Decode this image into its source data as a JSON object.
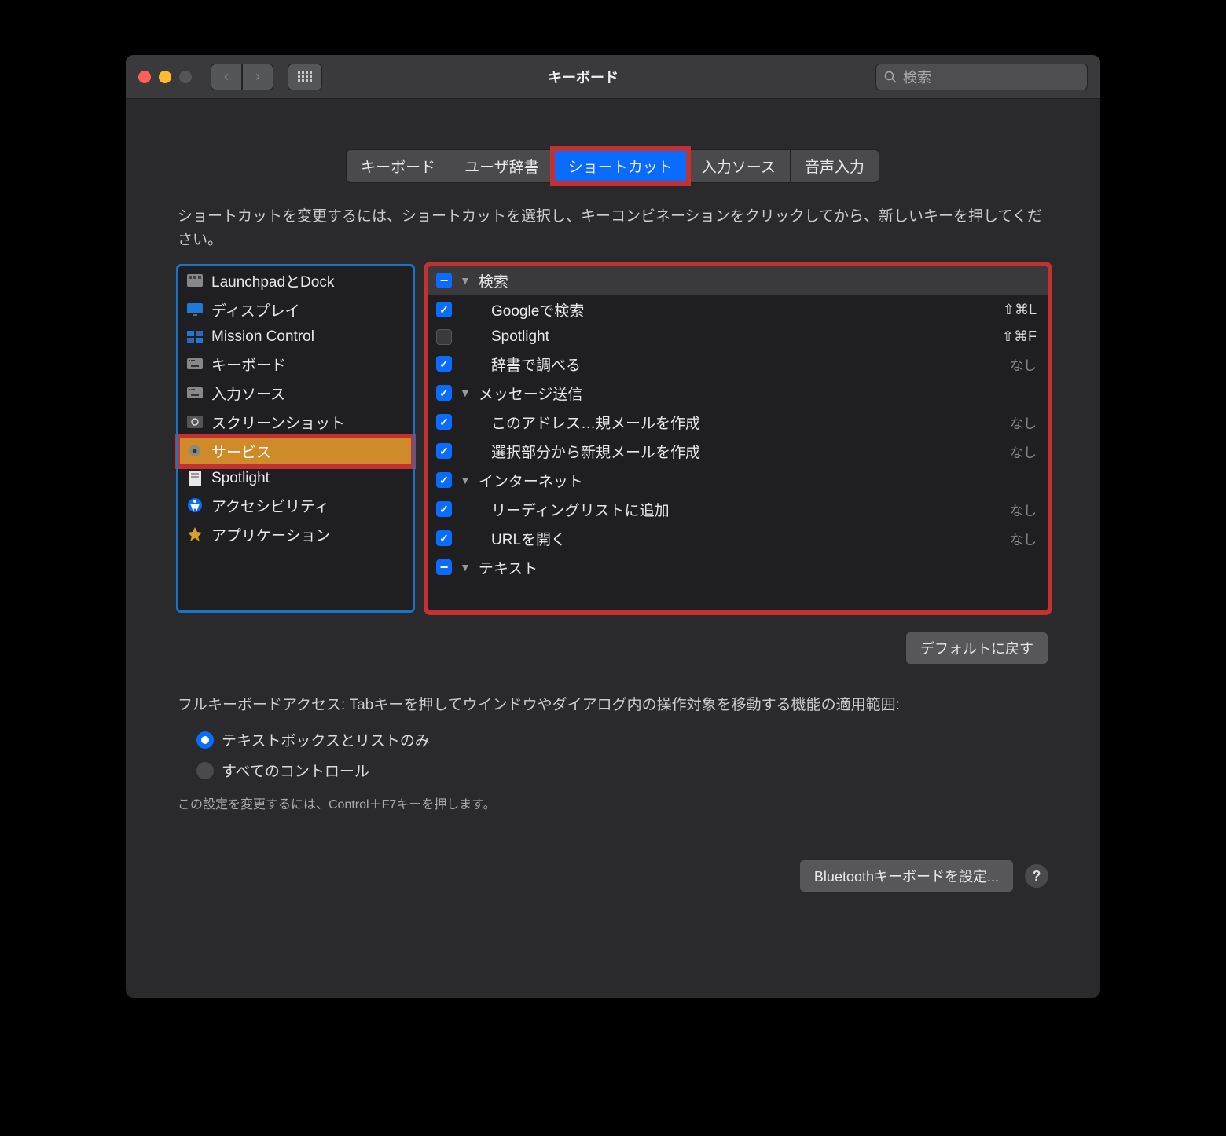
{
  "window": {
    "title": "キーボード",
    "search_placeholder": "検索"
  },
  "tabs": [
    {
      "label": "キーボード",
      "active": false
    },
    {
      "label": "ユーザ辞書",
      "active": false
    },
    {
      "label": "ショートカット",
      "active": true,
      "highlight": true
    },
    {
      "label": "入力ソース",
      "active": false
    },
    {
      "label": "音声入力",
      "active": false
    }
  ],
  "instructions": "ショートカットを変更するには、ショートカットを選択し、キーコンビネーションをクリックしてから、新しいキーを押してください。",
  "sidebar": {
    "items": [
      {
        "label": "LaunchpadとDock",
        "icon": "launchpad"
      },
      {
        "label": "ディスプレイ",
        "icon": "display"
      },
      {
        "label": "Mission Control",
        "icon": "mission"
      },
      {
        "label": "キーボード",
        "icon": "keyboard"
      },
      {
        "label": "入力ソース",
        "icon": "keyboard"
      },
      {
        "label": "スクリーンショット",
        "icon": "screenshot"
      },
      {
        "label": "サービス",
        "icon": "gear",
        "selected": true
      },
      {
        "label": "Spotlight",
        "icon": "spotlight"
      },
      {
        "label": "アクセシビリティ",
        "icon": "accessibility"
      },
      {
        "label": "アプリケーション",
        "icon": "app"
      }
    ]
  },
  "shortcuts": [
    {
      "type": "group",
      "cb": "mixed",
      "label": "検索"
    },
    {
      "type": "item",
      "cb": "checked",
      "label": "Googleで検索",
      "shortcut": "⇧⌘L"
    },
    {
      "type": "item",
      "cb": "off",
      "label": "Spotlight",
      "shortcut": "⇧⌘F"
    },
    {
      "type": "item",
      "cb": "checked",
      "label": "辞書で調べる",
      "shortcut_none": "なし"
    },
    {
      "type": "group",
      "cb": "checked",
      "label": "メッセージ送信"
    },
    {
      "type": "item",
      "cb": "checked",
      "label": "このアドレス…規メールを作成",
      "shortcut_none": "なし"
    },
    {
      "type": "item",
      "cb": "checked",
      "label": "選択部分から新規メールを作成",
      "shortcut_none": "なし"
    },
    {
      "type": "group",
      "cb": "checked",
      "label": "インターネット"
    },
    {
      "type": "item",
      "cb": "checked",
      "label": "リーディングリストに追加",
      "shortcut_none": "なし"
    },
    {
      "type": "item",
      "cb": "checked",
      "label": "URLを開く",
      "shortcut_none": "なし"
    },
    {
      "type": "group",
      "cb": "mixed",
      "label": "テキスト"
    }
  ],
  "defaults_button": "デフォルトに戻す",
  "full_access": {
    "text": "フルキーボードアクセス: Tabキーを押してウインドウやダイアログ内の操作対象を移動する機能の適用範囲:",
    "option1": "テキストボックスとリストのみ",
    "option2": "すべてのコントロール",
    "hint": "この設定を変更するには、Control＋F7キーを押します。"
  },
  "footer": {
    "bluetooth": "Bluetoothキーボードを設定...",
    "help": "?"
  }
}
